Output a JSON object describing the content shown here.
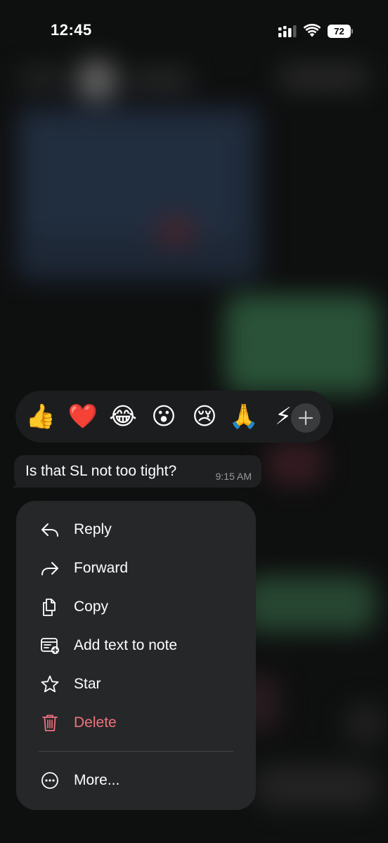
{
  "status_bar": {
    "time": "12:45",
    "battery_level": "72"
  },
  "reactions": {
    "items": [
      {
        "emoji": "👍",
        "name": "thumbs-up"
      },
      {
        "emoji": "❤️",
        "name": "red-heart"
      },
      {
        "emoji": "😂",
        "name": "face-with-tears-of-joy"
      },
      {
        "emoji": "😮",
        "name": "face-with-open-mouth"
      },
      {
        "emoji": "😢",
        "name": "crying-face"
      },
      {
        "emoji": "🙏",
        "name": "folded-hands"
      },
      {
        "emoji": "⚡",
        "name": "high-voltage"
      }
    ],
    "more_icon": "plus-icon"
  },
  "message": {
    "text": "Is that SL not too tight?",
    "time": "9:15 AM"
  },
  "menu": {
    "items": [
      {
        "label": "Reply",
        "icon": "reply-icon"
      },
      {
        "label": "Forward",
        "icon": "forward-icon"
      },
      {
        "label": "Copy",
        "icon": "copy-icon"
      },
      {
        "label": "Add text to note",
        "icon": "note-icon"
      },
      {
        "label": "Star",
        "icon": "star-icon"
      },
      {
        "label": "Delete",
        "icon": "trash-icon"
      }
    ],
    "more_label": "More...",
    "more_icon": "ellipsis-circle-icon"
  },
  "colors": {
    "menu_background": "#262728",
    "destructive": "#f0727e",
    "bubble_background": "#1f2021",
    "reaction_bar_background": "#1c1d1e"
  }
}
